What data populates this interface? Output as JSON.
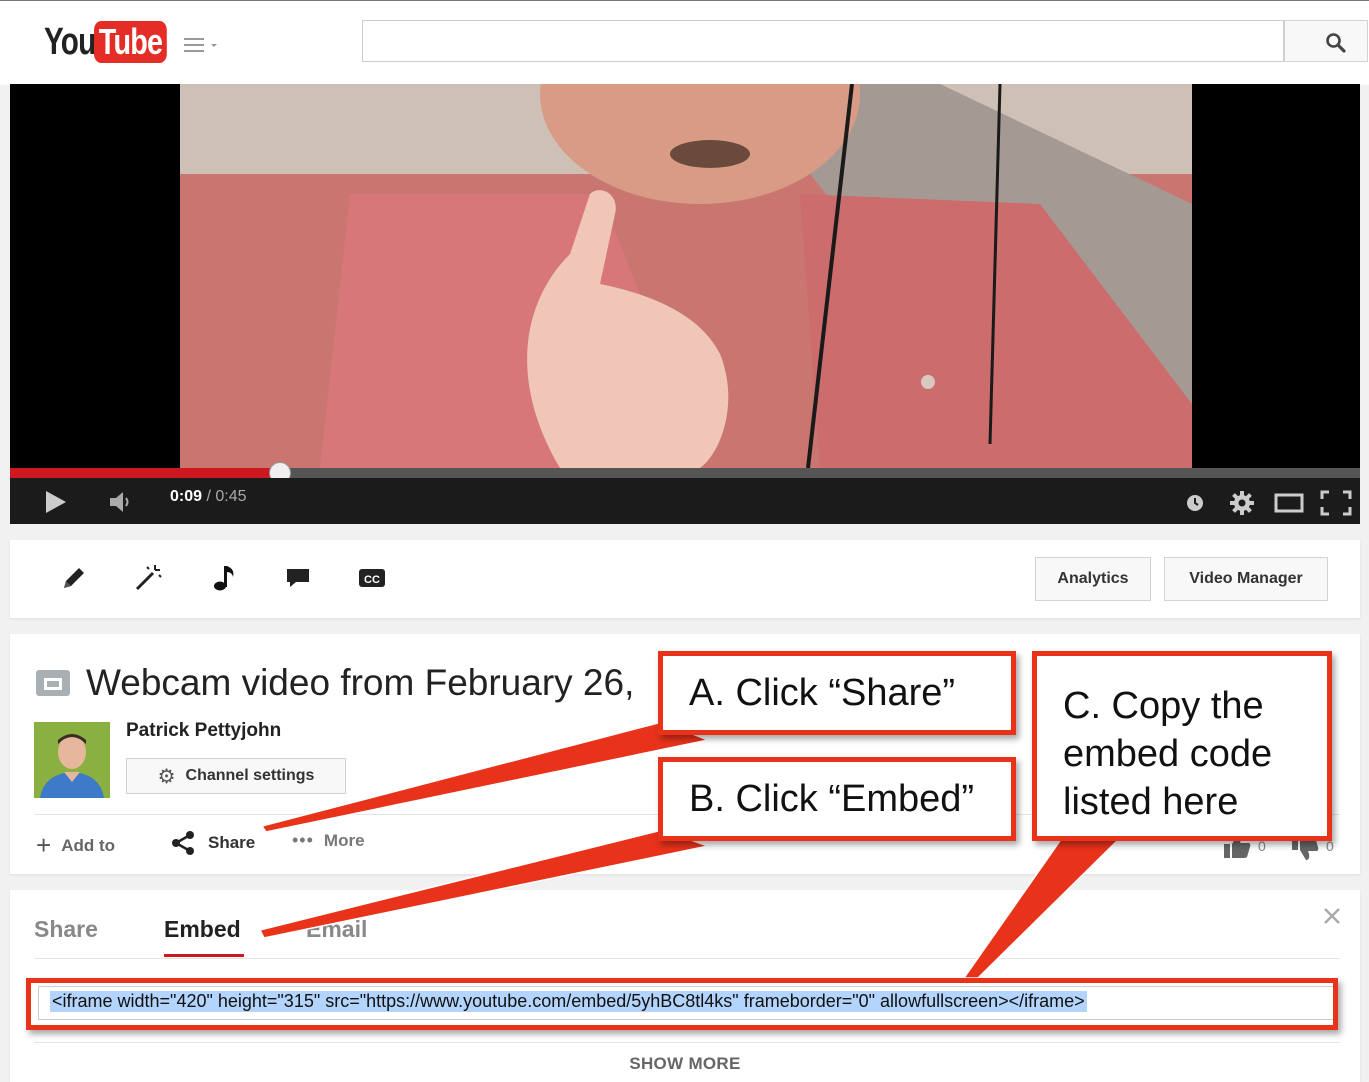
{
  "header": {
    "logo_you": "You",
    "logo_tube": "Tube",
    "guide_icon": "hamburger-menu-icon",
    "search": {
      "value": "",
      "placeholder": ""
    },
    "search_icon": "magnifier-icon"
  },
  "player": {
    "current_time": "0:09",
    "separator": "/",
    "duration": "0:45",
    "progress_fraction": 0.2,
    "icons": [
      "play-icon",
      "volume-icon",
      "watch-later-icon",
      "settings-gear-icon",
      "theater-mode-icon",
      "fullscreen-icon"
    ]
  },
  "creator_bar": {
    "tools": [
      "pencil-edit-icon",
      "magic-wand-enhancements-icon",
      "music-note-audio-icon",
      "speech-bubble-annotations-icon",
      "cc-captions-icon"
    ],
    "analytics_label": "Analytics",
    "video_manager_label": "Video Manager"
  },
  "video_info": {
    "title": "Webcam video from February 26,",
    "author": "Patrick Pettyjohn",
    "channel_settings_label": "Channel settings",
    "actions": {
      "add_to": "Add to",
      "share": "Share",
      "more": "More"
    },
    "like_count": "0",
    "dislike_count": "0"
  },
  "share_panel": {
    "tabs": {
      "share": "Share",
      "embed": "Embed",
      "email": "Email"
    },
    "active_tab": "Embed",
    "embed_code": "<iframe width=\"420\" height=\"315\" src=\"https://www.youtube.com/embed/5yhBC8tl4ks\" frameborder=\"0\" allowfullscreen></iframe>",
    "show_more_label": "SHOW MORE"
  },
  "annotations": {
    "a": "A. Click “Share”",
    "b": "B. Click “Embed”",
    "c": "C. Copy the embed code listed here",
    "color": "#e8321a"
  },
  "colors": {
    "youtube_red": "#e52d27",
    "progress_red": "#cc181e",
    "selection_blue": "#b3d4fc"
  }
}
